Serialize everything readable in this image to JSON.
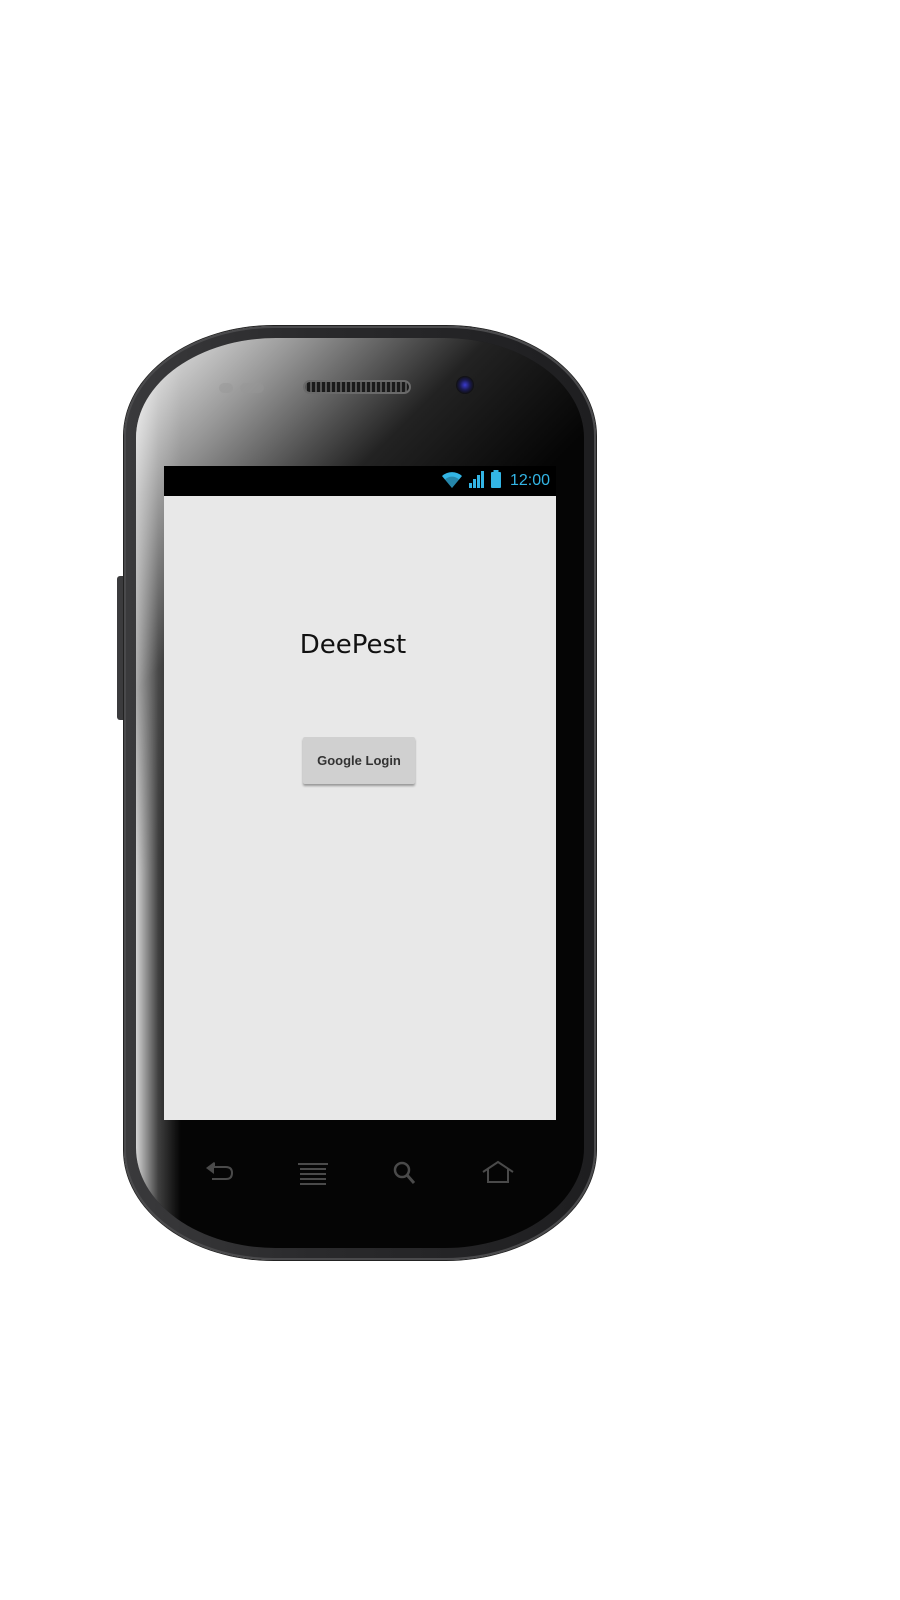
{
  "device": {
    "frame": "android-phone"
  },
  "status_bar": {
    "time": "12:00",
    "icons": [
      "wifi-icon",
      "cell-signal-icon",
      "battery-icon"
    ],
    "accent_color": "#33b5e5"
  },
  "app": {
    "title": "DeePest",
    "login_button_label": "Google Login"
  },
  "nav_keys": [
    "back-icon",
    "menu-icon",
    "search-icon",
    "home-icon"
  ]
}
